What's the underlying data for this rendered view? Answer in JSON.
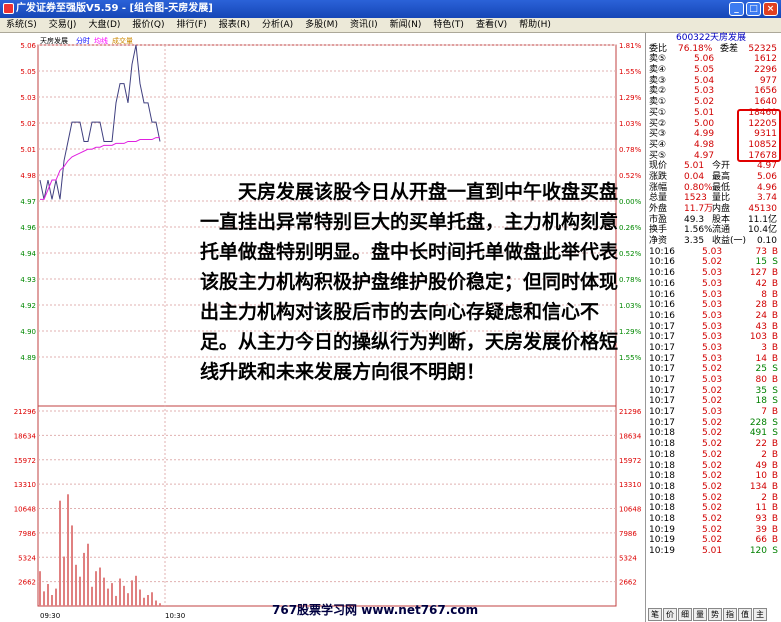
{
  "window": {
    "title": "广发证券至强版V5.59 - [组合图-天房发展]",
    "min": "_",
    "max": "□",
    "close": "×"
  },
  "menu": [
    "系统(S)",
    "交易(J)",
    "大盘(D)",
    "报价(Q)",
    "排行(F)",
    "报表(R)",
    "分析(A)",
    "多股(M)",
    "资讯(I)",
    "新闻(N)",
    "特色(T)",
    "查看(V)",
    "帮助(H)"
  ],
  "chart": {
    "stock_name": "天房发展",
    "legend": [
      "分时",
      "均线",
      "成交量"
    ],
    "price_labels_left": [
      "5.06",
      "5.05",
      "5.03",
      "5.02",
      "5.01",
      "4.98",
      "4.97",
      "4.96",
      "4.94",
      "4.93",
      "4.92",
      "4.90",
      "4.89"
    ],
    "pct_labels_right": [
      "1.81%",
      "1.55%",
      "1.29%",
      "1.03%",
      "0.78%",
      "0.52%",
      "0.00%",
      "0.26%",
      "0.52%",
      "0.78%",
      "1.03%",
      "1.29%",
      "1.55%"
    ],
    "vol_labels": [
      "21296",
      "18634",
      "15972",
      "13310",
      "10648",
      "7986",
      "5324",
      "2662"
    ],
    "time_labels": [
      "09:30",
      "10:30"
    ]
  },
  "chart_data": {
    "type": "line",
    "series": [
      {
        "name": "分时",
        "values": [
          4.99,
          4.98,
          4.99,
          4.98,
          4.99,
          4.98,
          5.0,
          5.01,
          5.02,
          5.02,
          5.02,
          5.01,
          5.01,
          5.02,
          5.02,
          5.02,
          5.01,
          5.01,
          5.01,
          5.03,
          5.04,
          5.04,
          5.03,
          5.05,
          5.06,
          5.04,
          5.03,
          5.03,
          5.02,
          5.02,
          5.01
        ]
      },
      {
        "name": "均线",
        "values": [
          4.98,
          4.98,
          4.985,
          4.99,
          4.99,
          4.995,
          4.997,
          5.0,
          5.002,
          5.003,
          5.004,
          5.005,
          5.006,
          5.006,
          5.007,
          5.007,
          5.008,
          5.008,
          5.008,
          5.009,
          5.009,
          5.009,
          5.01,
          5.01,
          5.01,
          5.011,
          5.011,
          5.011,
          5.011,
          5.012,
          5.012
        ]
      },
      {
        "name": "成交量",
        "values": [
          3800,
          1600,
          2400,
          1200,
          1900,
          11500,
          5400,
          12200,
          8800,
          4500,
          3200,
          5800,
          6800,
          2100,
          3800,
          4200,
          3100,
          1900,
          2500,
          1100,
          3000,
          2200,
          1400,
          2800,
          3300,
          1800,
          900,
          1200,
          1500,
          600,
          300
        ]
      }
    ],
    "ylim": [
      4.89,
      5.06
    ]
  },
  "overlay_text": "天房发展该股今日从开盘一直到中午收盘买盘一直挂出异常特别巨大的买单托盘，主力机构刻意托单做盘特别明显。盘中长时间托单做盘此举代表该股主力机构积极护盘维护股价稳定；但同时体现出主力机构对该股后市的去向心存疑虑和信心不足。从主力今日的操纵行为判断，天房发展价格短线升跌和未来发展方向很不明朗！",
  "footer": "767股票学习网 www.net767.com",
  "quote": {
    "code": "600322",
    "name": "天房发展",
    "wb_label": "委比",
    "wb_val": "76.18%",
    "wc_label": "委差",
    "wc_val": "52325",
    "sells": [
      {
        "label": "卖⑤",
        "price": "5.06",
        "vol": "1612"
      },
      {
        "label": "卖④",
        "price": "5.05",
        "vol": "2296"
      },
      {
        "label": "卖③",
        "price": "5.04",
        "vol": "977"
      },
      {
        "label": "卖②",
        "price": "5.03",
        "vol": "1656"
      },
      {
        "label": "卖①",
        "price": "5.02",
        "vol": "1640"
      }
    ],
    "buys": [
      {
        "label": "买①",
        "price": "5.01",
        "vol": "18460"
      },
      {
        "label": "买②",
        "price": "5.00",
        "vol": "12205"
      },
      {
        "label": "买③",
        "price": "4.99",
        "vol": "9311"
      },
      {
        "label": "买④",
        "price": "4.98",
        "vol": "10852"
      },
      {
        "label": "买⑤",
        "price": "4.97",
        "vol": "17678"
      }
    ],
    "stats": [
      {
        "l1": "现价",
        "v1": "5.01",
        "l2": "今开",
        "v2": "4.97"
      },
      {
        "l1": "涨跌",
        "v1": "0.04",
        "l2": "最高",
        "v2": "5.06"
      },
      {
        "l1": "涨幅",
        "v1": "0.80%",
        "l2": "最低",
        "v2": "4.96"
      },
      {
        "l1": "总量",
        "v1": "1523",
        "l2": "量比",
        "v2": "3.74"
      },
      {
        "l1": "外盘",
        "v1": "11.7万",
        "l2": "内盘",
        "v2": "45130"
      }
    ],
    "stats2": [
      {
        "l1": "市盈",
        "v1": "49.3",
        "l2": "股本",
        "v2": "11.1亿"
      },
      {
        "l1": "换手",
        "v1": "1.56%",
        "l2": "流通",
        "v2": "10.4亿"
      },
      {
        "l1": "净资",
        "v1": "3.35",
        "l2": "收益(一)",
        "v2": "0.10"
      }
    ],
    "ticks": [
      [
        "10:16",
        "5.03",
        "73",
        "B"
      ],
      [
        "10:16",
        "5.02",
        "15",
        "S"
      ],
      [
        "10:16",
        "5.03",
        "127",
        "B"
      ],
      [
        "10:16",
        "5.03",
        "42",
        "B"
      ],
      [
        "10:16",
        "5.03",
        "8",
        "B"
      ],
      [
        "10:16",
        "5.03",
        "28",
        "B"
      ],
      [
        "10:16",
        "5.03",
        "24",
        "B"
      ],
      [
        "10:17",
        "5.03",
        "43",
        "B"
      ],
      [
        "10:17",
        "5.03",
        "103",
        "B"
      ],
      [
        "10:17",
        "5.03",
        "3",
        "B"
      ],
      [
        "10:17",
        "5.03",
        "14",
        "B"
      ],
      [
        "10:17",
        "5.02",
        "25",
        "S"
      ],
      [
        "10:17",
        "5.03",
        "80",
        "B"
      ],
      [
        "10:17",
        "5.02",
        "35",
        "S"
      ],
      [
        "10:17",
        "5.02",
        "18",
        "S"
      ],
      [
        "10:17",
        "5.03",
        "7",
        "B"
      ],
      [
        "10:17",
        "5.02",
        "228",
        "S"
      ],
      [
        "10:18",
        "5.02",
        "491",
        "S"
      ],
      [
        "10:18",
        "5.02",
        "22",
        "B"
      ],
      [
        "10:18",
        "5.02",
        "2",
        "B"
      ],
      [
        "10:18",
        "5.02",
        "49",
        "B"
      ],
      [
        "10:18",
        "5.02",
        "10",
        "B"
      ],
      [
        "10:18",
        "5.02",
        "134",
        "B"
      ],
      [
        "10:18",
        "5.02",
        "2",
        "B"
      ],
      [
        "10:18",
        "5.02",
        "11",
        "B"
      ],
      [
        "10:18",
        "5.02",
        "93",
        "B"
      ],
      [
        "10:19",
        "5.02",
        "39",
        "B"
      ],
      [
        "10:19",
        "5.02",
        "66",
        "B"
      ],
      [
        "10:19",
        "5.01",
        "120",
        "S"
      ]
    ]
  },
  "tabs": [
    "笔",
    "价",
    "细",
    "量",
    "势",
    "指",
    "值",
    "主"
  ]
}
